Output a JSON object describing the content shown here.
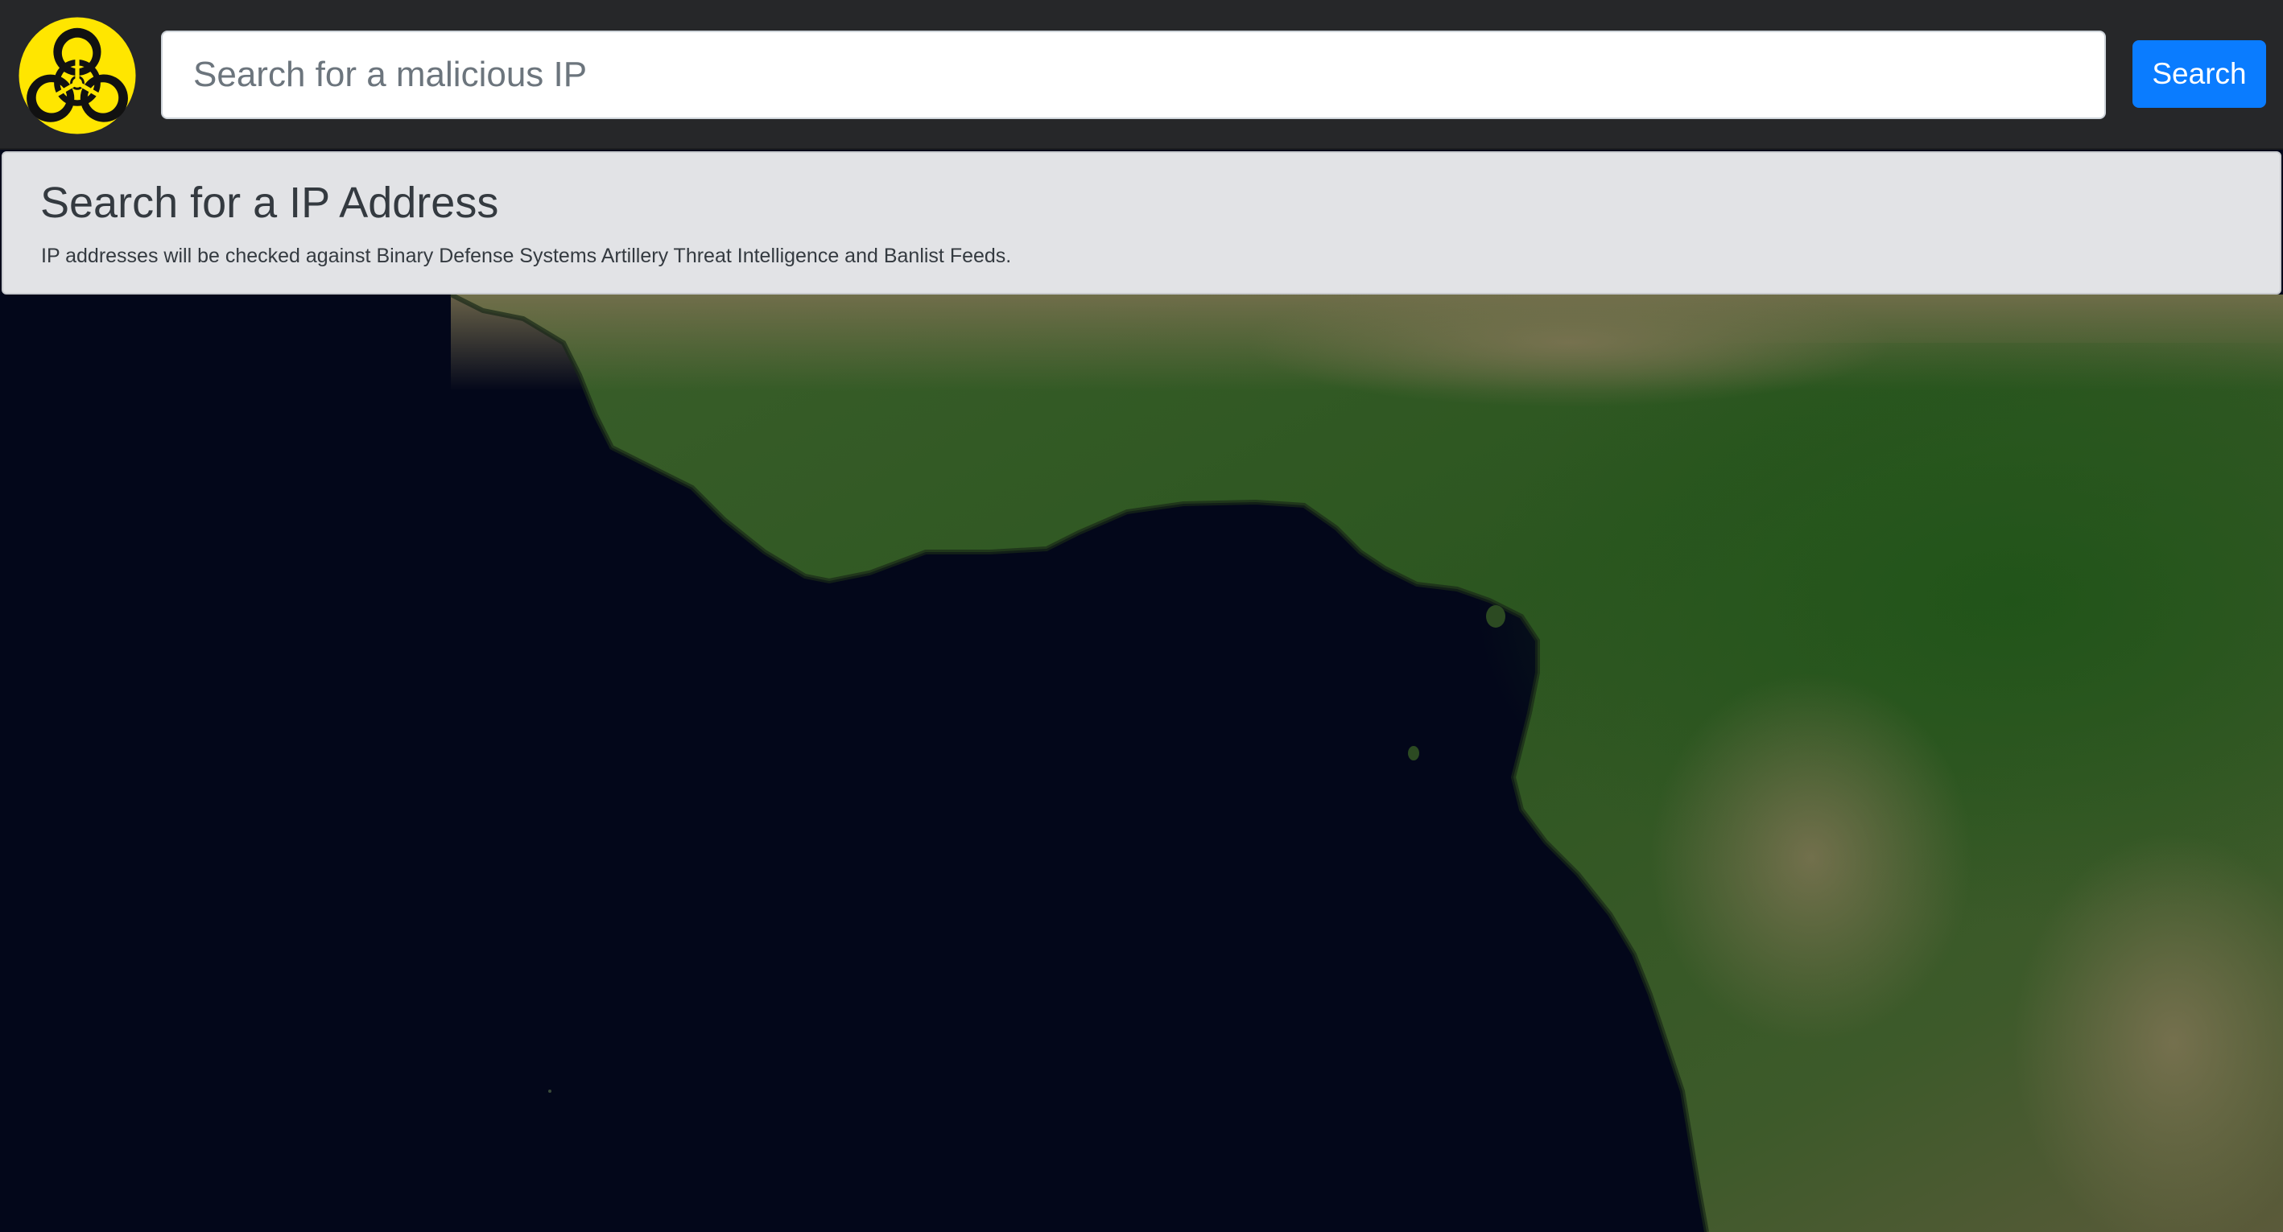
{
  "header": {
    "logo_icon": "biohazard-icon",
    "logo_color": "#FFE600",
    "search": {
      "placeholder": "Search for a malicious IP",
      "value": ""
    },
    "search_button_label": "Search",
    "accent_color": "#0A7CFF"
  },
  "jumbotron": {
    "title": "Search for a IP Address",
    "lead": "IP addresses will be checked against Binary Defense Systems Artillery Threat Intelligence and Banlist Feeds."
  },
  "map": {
    "style": "satellite imagery",
    "ocean_color": "#03071A",
    "land_color": "#2F5A23"
  }
}
